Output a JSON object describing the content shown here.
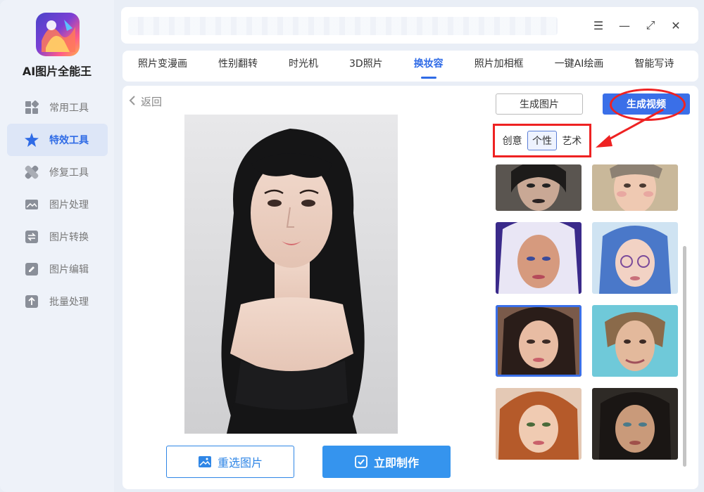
{
  "app": {
    "title": "AI图片全能王"
  },
  "sidebar": {
    "items": [
      {
        "label": "常用工具",
        "icon": "grid-icon"
      },
      {
        "label": "特效工具",
        "icon": "star-icon",
        "active": true
      },
      {
        "label": "修复工具",
        "icon": "bandage-icon"
      },
      {
        "label": "图片处理",
        "icon": "image-icon"
      },
      {
        "label": "图片转换",
        "icon": "convert-icon"
      },
      {
        "label": "图片编辑",
        "icon": "edit-icon"
      },
      {
        "label": "批量处理",
        "icon": "upload-icon"
      }
    ]
  },
  "window": {
    "menu": "☰",
    "minimize": "—",
    "maximize": "⤢",
    "close": "✕"
  },
  "tabs": [
    {
      "label": "照片变漫画"
    },
    {
      "label": "性别翻转"
    },
    {
      "label": "时光机"
    },
    {
      "label": "3D照片"
    },
    {
      "label": "换妆容",
      "active": true
    },
    {
      "label": "照片加相框"
    },
    {
      "label": "一键AI绘画"
    },
    {
      "label": "智能写诗"
    }
  ],
  "main": {
    "back_label": "返回",
    "reselect_label": "重选图片",
    "make_label": "立即制作"
  },
  "right": {
    "gen_image_label": "生成图片",
    "gen_video_label": "生成视频",
    "filters": [
      {
        "label": "创意"
      },
      {
        "label": "个性",
        "active": true
      },
      {
        "label": "艺术"
      }
    ],
    "selected_style_index": 4
  },
  "colors": {
    "accent": "#2f6be6",
    "primary_button": "#3594ee",
    "highlight_red": "#e22222"
  }
}
